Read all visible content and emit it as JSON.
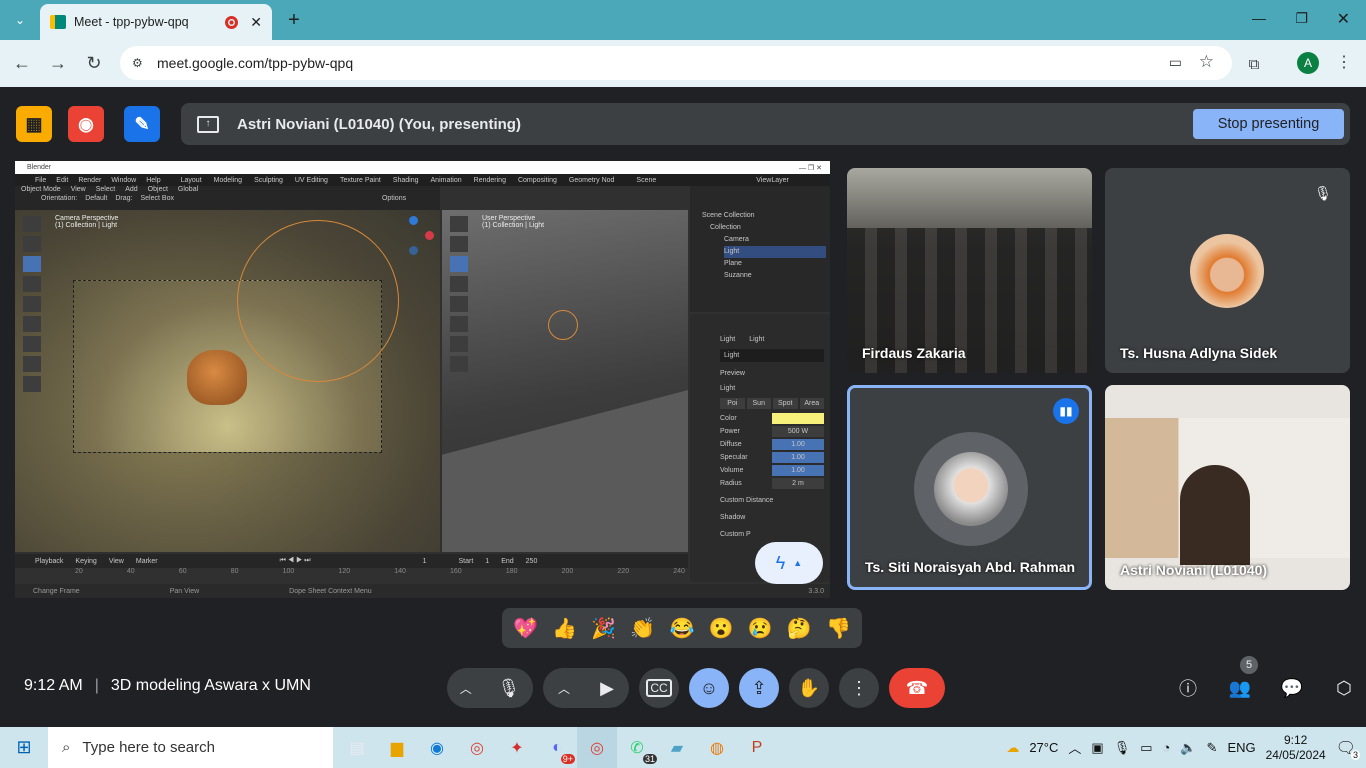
{
  "browser": {
    "tab_title": "Meet - tpp-pybw-qpq",
    "url": "meet.google.com/tpp-pybw-qpq",
    "profile_initial": "A"
  },
  "meet": {
    "presenting_text": "Astri Noviani (L01040) (You, presenting)",
    "stop_label": "Stop presenting",
    "time": "9:12 AM",
    "meeting_name": "3D modeling Aswara x UMN",
    "participants_count": "5",
    "participants": [
      {
        "name": "Firdaus Zakaria"
      },
      {
        "name": "Ts. Husna Adlyna Sidek"
      },
      {
        "name": "Ts. Siti Noraisyah Abd. Rahman"
      },
      {
        "name": "Astri Noviani (L01040)"
      }
    ],
    "reactions": [
      "💖",
      "👍",
      "🎉",
      "👏",
      "😂",
      "😮",
      "😢",
      "🤔",
      "👎"
    ]
  },
  "blender": {
    "title": "Blender",
    "menus": [
      "File",
      "Edit",
      "Render",
      "Window",
      "Help"
    ],
    "workspaces": [
      "Layout",
      "Modeling",
      "Sculpting",
      "UV Editing",
      "Texture Paint",
      "Shading",
      "Animation",
      "Rendering",
      "Compositing",
      "Geometry Nod"
    ],
    "scene": "Scene",
    "view_layer": "ViewLayer",
    "left_view": "Camera Perspective",
    "left_sub": "(1) Collection | Light",
    "right_view": "User Perspective",
    "right_sub": "(1) Collection | Light",
    "mode": "Object Mode",
    "vp_menus": [
      "View",
      "Select",
      "Add",
      "Object"
    ],
    "transform": "Global",
    "orientation_label": "Orientation:",
    "orientation": "Default",
    "drag_label": "Drag:",
    "drag": "Select Box",
    "options": "Options",
    "outliner": {
      "root": "Scene Collection",
      "collection": "Collection",
      "items": [
        "Camera",
        "Light",
        "Plane",
        "Suzanne"
      ]
    },
    "props": {
      "breadcrumb_a": "Light",
      "breadcrumb_b": "Light",
      "name": "Light",
      "preview": "Preview",
      "section": "Light",
      "types": [
        "Poi",
        "Sun",
        "Spot",
        "Area"
      ],
      "rows": [
        {
          "label": "Color",
          "value": ""
        },
        {
          "label": "Power",
          "value": "500 W"
        },
        {
          "label": "Diffuse",
          "value": "1.00"
        },
        {
          "label": "Specular",
          "value": "1.00"
        },
        {
          "label": "Volume",
          "value": "1.00"
        },
        {
          "label": "Radius",
          "value": "2 m"
        }
      ],
      "custom_distance": "Custom Distance",
      "shadow": "Shadow",
      "custom_p": "Custom P"
    },
    "timeline": {
      "menus": [
        "Playback",
        "Keying",
        "View",
        "Marker"
      ],
      "frame": "1",
      "start_label": "Start",
      "start": "1",
      "end_label": "End",
      "end": "250",
      "ticks": [
        "20",
        "40",
        "60",
        "80",
        "100",
        "120",
        "140",
        "160",
        "180",
        "200",
        "220",
        "240"
      ]
    },
    "status": [
      "Change Frame",
      "Pan View",
      "Dope Sheet Context Menu"
    ],
    "version": "3.3.0"
  },
  "taskbar": {
    "search_placeholder": "Type here to search",
    "weather": "27°C",
    "lang": "ENG",
    "clock_time": "9:12",
    "clock_date": "24/05/2024",
    "notif": "3",
    "whatsapp_badge": "31",
    "discord_badge": "9+"
  },
  "colors": {
    "meet_bg": "#202124",
    "tile": "#3c4043",
    "accent": "#8ab4f8",
    "end_call": "#ea4335",
    "chrome_tab": "#4ba8b8"
  }
}
